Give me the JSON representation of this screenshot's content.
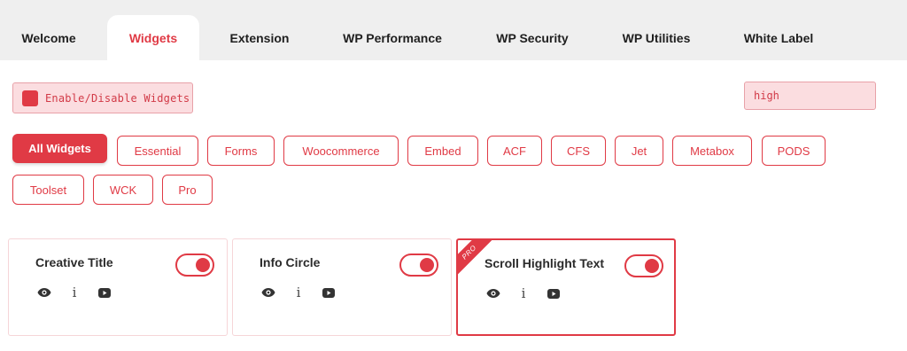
{
  "tabs": [
    {
      "label": "Welcome"
    },
    {
      "label": "Widgets",
      "active": true
    },
    {
      "label": "Extension"
    },
    {
      "label": "WP Performance"
    },
    {
      "label": "WP Security"
    },
    {
      "label": "WP Utilities"
    },
    {
      "label": "White Label"
    }
  ],
  "toolbar": {
    "toggle_all_label": "Enable/Disable Widgets",
    "search_value": "high"
  },
  "filters": [
    {
      "label": "All Widgets",
      "active": true
    },
    {
      "label": "Essential"
    },
    {
      "label": "Forms"
    },
    {
      "label": "Woocommerce"
    },
    {
      "label": "Embed"
    },
    {
      "label": "ACF"
    },
    {
      "label": "CFS"
    },
    {
      "label": "Jet"
    },
    {
      "label": "Metabox"
    },
    {
      "label": "PODS"
    },
    {
      "label": "Toolset"
    },
    {
      "label": "WCK"
    },
    {
      "label": "Pro"
    }
  ],
  "widgets": [
    {
      "title": "Creative Title",
      "enabled": true,
      "pro": false
    },
    {
      "title": "Info Circle",
      "enabled": true,
      "pro": false
    },
    {
      "title": "Scroll Highlight Text",
      "enabled": true,
      "pro": true,
      "badge": "PRO"
    }
  ],
  "colors": {
    "accent": "#e03a45",
    "tabbar_bg": "#efefef",
    "field_bg": "#fbdde0"
  },
  "icons": {
    "preview": "eye-icon",
    "info": "info-icon",
    "video": "youtube-icon"
  }
}
